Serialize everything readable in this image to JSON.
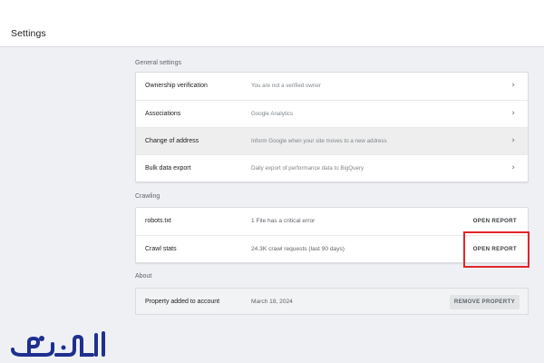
{
  "header": {
    "title": "Settings"
  },
  "general": {
    "label": "General settings",
    "rows": [
      {
        "label": "Ownership verification",
        "desc": "You are not a verified owner"
      },
      {
        "label": "Associations",
        "desc": "Google Analytics"
      },
      {
        "label": "Change of address",
        "desc": "Inform Google when your site moves to a new address"
      },
      {
        "label": "Bulk data export",
        "desc": "Daily export of performance data to BigQuery"
      }
    ]
  },
  "crawling": {
    "label": "Crawling",
    "rows": [
      {
        "label": "robots.txt",
        "desc": "1 File has a critical error",
        "action": "OPEN REPORT"
      },
      {
        "label": "Crawl stats",
        "desc": "24.3K crawl requests (last 90 days)",
        "action": "OPEN REPORT"
      }
    ]
  },
  "about": {
    "label": "About",
    "property_label": "Property added to account",
    "date": "March 18, 2024",
    "remove_label": "REMOVE PROPERTY"
  },
  "colors": {
    "highlight_box": "#e0262b",
    "logo": "#1f2f8f"
  },
  "icons": {
    "row_arrow": "chevron-right-icon"
  },
  "watermark": {
    "text": "الوهيمي"
  }
}
